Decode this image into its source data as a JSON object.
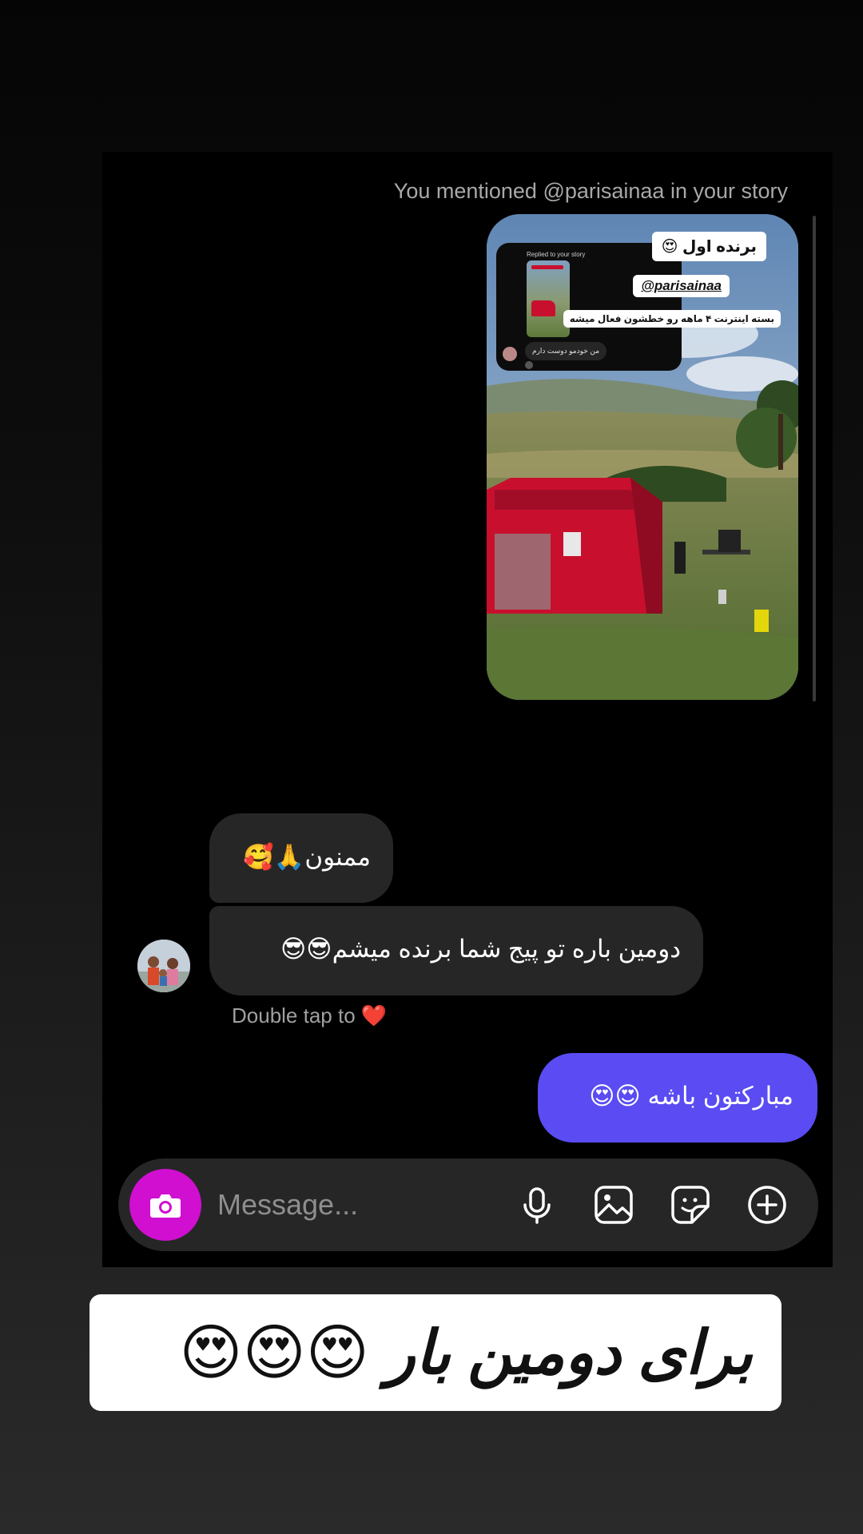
{
  "chat": {
    "mention_note": "You mentioned @parisainaa in your story",
    "story": {
      "label_title": "برنده اول 😍",
      "label_handle": "@parisainaa",
      "label_detail": "بسته اینترنت ۴ ماهه رو خطشون فعال میشه",
      "mini_header": "Replied to your story",
      "mini_message": "من خودمو دوست دارم"
    },
    "emoji_row": "😍😍😅😅",
    "bubble_thanks": "ممنون🙏🥰",
    "bubble_second": "دومین باره تو پیج شما برنده میشم😎😎",
    "double_tap": "Double tap to ❤️",
    "my_reply": "مبارکتون باشه 😍😍"
  },
  "composer": {
    "placeholder": "Message...",
    "icons": [
      "camera-icon",
      "microphone-icon",
      "gallery-icon",
      "sticker-icon",
      "plus-icon"
    ],
    "camera_color": "#d00fd0"
  },
  "caption": {
    "text": "برای دومین بار 😍😍😍"
  },
  "colors": {
    "my_bubble": "#5a4cf2",
    "their_bubble": "#262626",
    "tent": "#c8102e"
  }
}
